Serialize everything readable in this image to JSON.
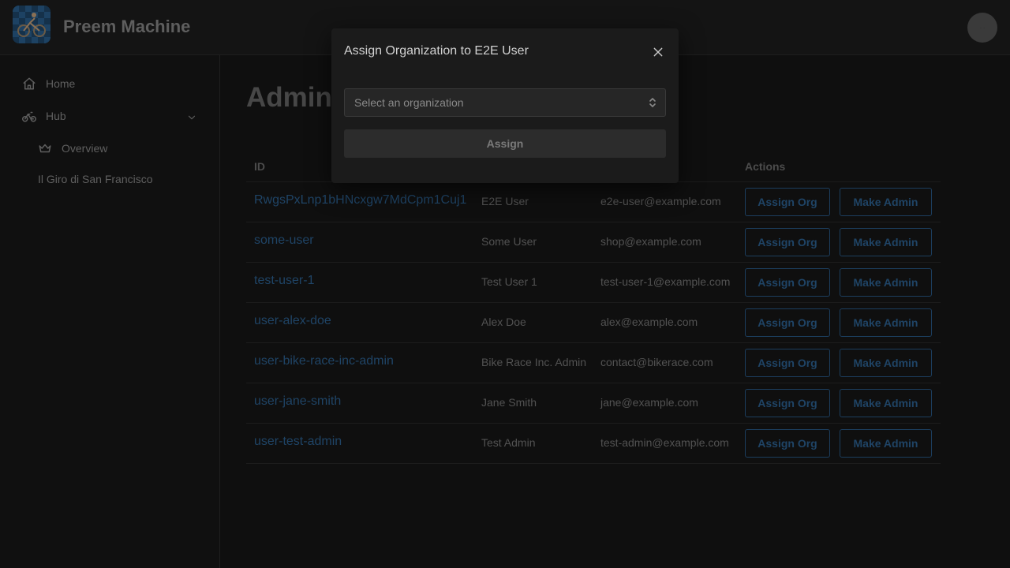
{
  "header": {
    "app_title": "Preem Machine",
    "avatar_text": "·· ··"
  },
  "sidebar": {
    "items": [
      {
        "label": "Home",
        "icon": "home-icon"
      },
      {
        "label": "Hub",
        "icon": "bike-icon"
      },
      {
        "label": "Overview",
        "icon": "crown-icon"
      },
      {
        "label": "Il Giro di San Francisco"
      }
    ]
  },
  "main": {
    "title": "Admin",
    "table": {
      "headers": [
        "ID",
        "Actions"
      ],
      "rows": [
        {
          "id": "RwgsPxLnp1bHNcxgw7MdCpm1Cuj1",
          "name": "E2E User",
          "email": "e2e-user@example.com",
          "assign": "Assign Org",
          "admin": "Make Admin"
        },
        {
          "id": "some-user",
          "name": "Some User",
          "email": "shop@example.com",
          "assign": "Assign Org",
          "admin": "Make Admin"
        },
        {
          "id": "test-user-1",
          "name": "Test User 1",
          "email": "test-user-1@example.com",
          "assign": "Assign Org",
          "admin": "Make Admin"
        },
        {
          "id": "user-alex-doe",
          "name": "Alex Doe",
          "email": "alex@example.com",
          "assign": "Assign Org",
          "admin": "Make Admin"
        },
        {
          "id": "user-bike-race-inc-admin",
          "name": "Bike Race Inc. Admin",
          "email": "contact@bikerace.com",
          "assign": "Assign Org",
          "admin": "Make Admin"
        },
        {
          "id": "user-jane-smith",
          "name": "Jane Smith",
          "email": "jane@example.com",
          "assign": "Assign Org",
          "admin": "Make Admin"
        },
        {
          "id": "user-test-admin",
          "name": "Test Admin",
          "email": "test-admin@example.com",
          "assign": "Assign Org",
          "admin": "Make Admin"
        }
      ]
    }
  },
  "modal": {
    "title": "Assign Organization to E2E User",
    "select_placeholder": "Select an organization",
    "assign_label": "Assign"
  },
  "colors": {
    "link": "#1f4466",
    "background": "#0f0f0f",
    "modal_bg": "#1b1b1b"
  }
}
